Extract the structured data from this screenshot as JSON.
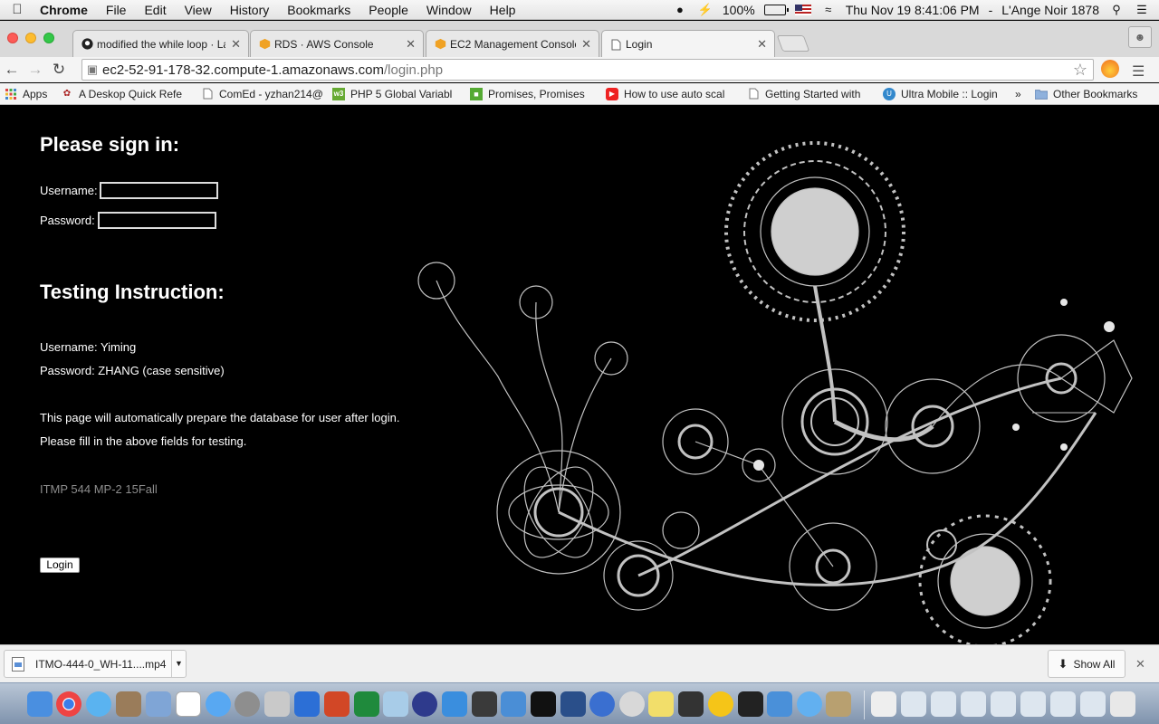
{
  "menubar": {
    "app_name": "Chrome",
    "items": [
      "File",
      "Edit",
      "View",
      "History",
      "Bookmarks",
      "People",
      "Window",
      "Help"
    ],
    "battery": "100%",
    "clock": "Thu Nov 19  8:41:06 PM",
    "user": "L'Ange Noir 1878"
  },
  "tabs": [
    {
      "title": "modified the while loop · La",
      "icon": "github-icon",
      "active": false
    },
    {
      "title": "RDS · AWS Console",
      "icon": "aws-icon",
      "active": false
    },
    {
      "title": "EC2 Management Console",
      "icon": "aws-icon",
      "active": false
    },
    {
      "title": "Login",
      "icon": "page-icon",
      "active": true
    }
  ],
  "address": {
    "host": "ec2-52-91-178-32.compute-1.amazonaws.com",
    "path": "/login.php"
  },
  "bookmarks": {
    "items": [
      "Apps",
      "A Deskop Quick Refe",
      "ComEd - yzhan214@",
      "PHP 5 Global Variabl",
      "Promises, Promises",
      "How to use auto scal",
      "Getting Started with",
      "Ultra Mobile :: Login"
    ],
    "overflow": "»",
    "other": "Other Bookmarks"
  },
  "page": {
    "signin_heading": "Please sign in:",
    "username_label": "Username:",
    "password_label": "Password:",
    "instruction_heading": "Testing Instruction:",
    "test_username": "Username: Yiming",
    "test_password": "Password: ZHANG (case sensitive)",
    "note_1": "This page will automatically prepare the database for user after login.",
    "note_2": "Please fill in the above fields for testing.",
    "course": "ITMP 544 MP-2 15Fall",
    "login_button": "Login"
  },
  "download_shelf": {
    "file_name": "ITMO-444-0_WH-11....mp4",
    "show_all": "Show All"
  },
  "colors": {
    "page_background": "#000000",
    "page_text": "#ffffff",
    "course_text": "#8d8d8d"
  }
}
